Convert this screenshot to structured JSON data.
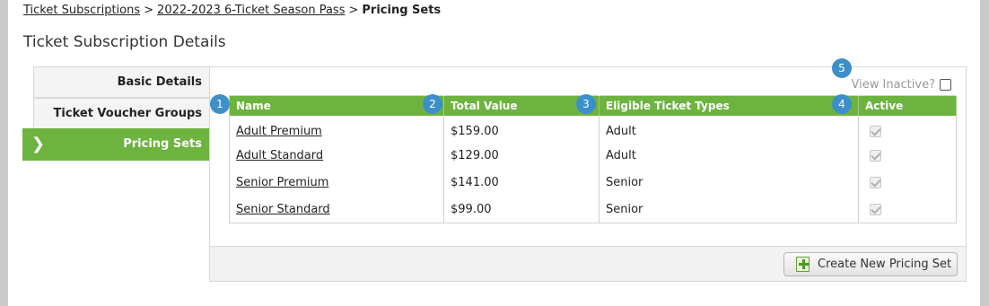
{
  "breadcrumb": {
    "items": [
      "Ticket Subscriptions",
      "2022-2023 6-Ticket Season Pass"
    ],
    "separator": ">",
    "current": "Pricing Sets"
  },
  "page_title": "Ticket Subscription Details",
  "tabs": [
    {
      "label": "Basic Details"
    },
    {
      "label": "Ticket Voucher Groups"
    },
    {
      "label": "Pricing Sets",
      "active": true
    }
  ],
  "view_inactive": {
    "label": "View Inactive?",
    "checked": false
  },
  "table": {
    "headers": [
      "Name",
      "Total Value",
      "Eligible Ticket Types",
      "Active"
    ],
    "rows": [
      {
        "name": "Adult Premium",
        "total_value": "$159.00",
        "eligible": "Adult",
        "active": true
      },
      {
        "name": "Adult Standard",
        "total_value": "$129.00",
        "eligible": "Adult",
        "active": true
      },
      {
        "name": "Senior Premium",
        "total_value": "$141.00",
        "eligible": "Senior",
        "active": true
      },
      {
        "name": "Senior Standard",
        "total_value": "$99.00",
        "eligible": "Senior",
        "active": true
      }
    ]
  },
  "create_button": {
    "label": "Create New Pricing Set",
    "icon": "add-document-icon"
  },
  "markers": [
    "1",
    "2",
    "3",
    "4",
    "5"
  ],
  "colors": {
    "accent": "#6db33f",
    "marker": "#3d8fc9"
  }
}
